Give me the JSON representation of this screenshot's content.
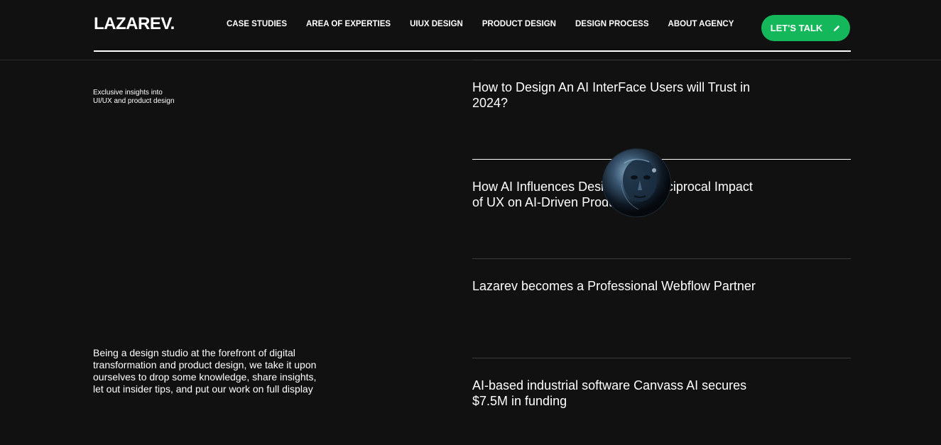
{
  "header": {
    "logo": "LAZAREV.",
    "nav": [
      {
        "label": "CASE STUDIES"
      },
      {
        "label": "AREA OF EXPERTIES"
      },
      {
        "label": "UIUX DESIGN"
      },
      {
        "label": "PRODUCT DESIGN"
      },
      {
        "label": "DESIGN PROCESS"
      },
      {
        "label": "ABOUT AGENCY"
      }
    ],
    "cta_label": "LET'S TALK",
    "cta_icon": "pencil-icon"
  },
  "sidebar": {
    "tagline": "Exclusive insights into\nUI/UX and product design",
    "intro": "Being a design studio at the forefront of digital transformation and product design, we take it upon ourselves to drop some knowledge, share insights, let out insider tips, and put our work on full display"
  },
  "articles": [
    {
      "title": "How to Design An AI InterFace Users will Trust in 2024?"
    },
    {
      "title": "How AI Influences Design: The Reciprocal Impact of UX on AI-Driven Products"
    },
    {
      "title": "Lazarev becomes a Professional Webflow Partner"
    },
    {
      "title": "AI-based industrial software Canvass AI secures $7.5M in funding"
    }
  ],
  "colors": {
    "background": "#111111",
    "accent": "#14b85a",
    "text": "#ffffff"
  }
}
